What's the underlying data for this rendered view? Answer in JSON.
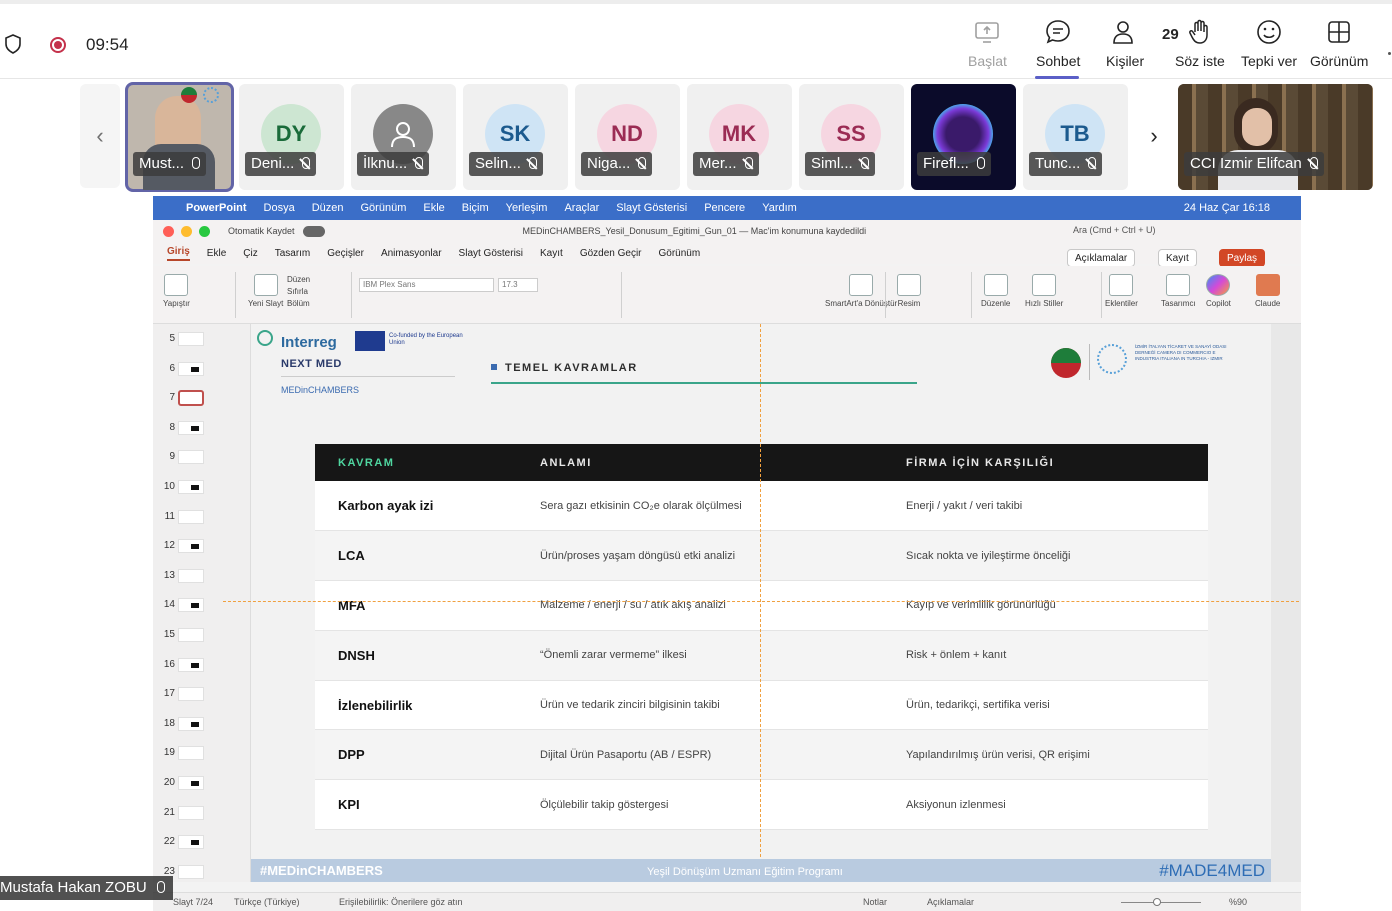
{
  "topbar": {
    "timer": "09:54",
    "buttons": [
      {
        "label": "Başlat",
        "icon": "share-screen-icon"
      },
      {
        "label": "Sohbet",
        "icon": "chat-icon"
      },
      {
        "label": "Kişiler",
        "icon": "people-icon",
        "count": "29"
      },
      {
        "label": "Söz iste",
        "icon": "raise-hand-icon"
      },
      {
        "label": "Tepki ver",
        "icon": "react-icon"
      },
      {
        "label": "Görünüm",
        "icon": "view-icon"
      }
    ],
    "accent": "#5b5fc7"
  },
  "participants": [
    {
      "initials": "",
      "name": "Must..."
    },
    {
      "initials": "DY",
      "name": "Deni..."
    },
    {
      "initials": "",
      "name": "İlknu..."
    },
    {
      "initials": "SK",
      "name": "Selin..."
    },
    {
      "initials": "ND",
      "name": "Niga..."
    },
    {
      "initials": "MK",
      "name": "Mer..."
    },
    {
      "initials": "SS",
      "name": "Siml..."
    },
    {
      "initials": "",
      "name": "Firefl..."
    },
    {
      "initials": "TB",
      "name": "Tunc..."
    }
  ],
  "pinned_video": {
    "name": "CCI Izmir Elifcan"
  },
  "presenter_name": "Mustafa Hakan ZOBU",
  "mac_menu": {
    "app": "PowerPoint",
    "items": [
      "Dosya",
      "Düzen",
      "Görünüm",
      "Ekle",
      "Biçim",
      "Yerleşim",
      "Araçlar",
      "Slayt Gösterisi",
      "Pencere",
      "Yardım"
    ],
    "clock": "24 Haz Çar  16:18"
  },
  "ppt": {
    "autosave": "Otomatik Kaydet",
    "filename": "MEDinCHAMBERS_Yesil_Donusum_Egitimi_Gun_01 — Mac'im konumuna kaydedildi",
    "search": "Ara (Cmd + Ctrl + U)",
    "tabs": [
      "Giriş",
      "Ekle",
      "Çiz",
      "Tasarım",
      "Geçişler",
      "Animasyonlar",
      "Slayt Gösterisi",
      "Kayıt",
      "Gözden Geçir",
      "Görünüm"
    ],
    "comments_btn": "Açıklamalar",
    "record_btn": "Kayıt",
    "share_btn": "Paylaş",
    "ribbon": {
      "paste": "Yapıştır",
      "new_slide": "Yeni Slayt",
      "layout": "Düzen",
      "reset": "Sıfırla",
      "section": "Bölüm",
      "font": "IBM Plex Sans",
      "size": "17.3",
      "smartart": "SmartArt'a Dönüştür",
      "picture": "Resim",
      "arrange": "Düzenle",
      "quick_styles": "Hızlı Stiller",
      "addins": "Eklentiler",
      "designer": "Tasarımcı",
      "copilot": "Copilot",
      "claude": "Claude"
    },
    "thumb_numbers": [
      "5",
      "6",
      "7",
      "8",
      "9",
      "10",
      "11",
      "12",
      "13",
      "14",
      "15",
      "16",
      "17",
      "18",
      "19",
      "20",
      "21",
      "22",
      "23"
    ],
    "status": {
      "slide": "Slayt 7/24",
      "lang": "Türkçe (Türkiye)",
      "access": "Erişilebilirlik: Önerilere göz atın",
      "notes": "Notlar",
      "comments": "Açıklamalar",
      "zoom": "%90"
    }
  },
  "slide": {
    "interreg": "Interreg",
    "eu_text": "Co-funded by the European Union",
    "next_med": "NEXT MED",
    "medin": "MEDinCHAMBERS",
    "section_title": "TEMEL KAVRAMLAR",
    "chamber_text": "İZMİR İTALYAN TİCARET VE SANAYİ ODASI DERNEĞİ CAMERA DI COMMERCIO E INDUSTRIA ITALIANA IN TURCHIA - IZMIR",
    "table": {
      "headers": [
        "KAVRAM",
        "ANLAMI",
        "FİRMA İÇİN KARŞILIĞI"
      ],
      "rows": [
        [
          "Karbon ayak izi",
          "Sera gazı etkisinin CO₂e olarak ölçülmesi",
          "Enerji / yakıt / veri takibi"
        ],
        [
          "LCA",
          "Ürün/proses yaşam döngüsü etki analizi",
          "Sıcak nokta ve iyileştirme önceliği"
        ],
        [
          "MFA",
          "Malzeme / enerji / su / atık akış analizi",
          "Kayıp ve verimlilik görünürlüğü"
        ],
        [
          "DNSH",
          "“Önemli zarar vermeme” ilkesi",
          "Risk + önlem + kanıt"
        ],
        [
          "İzlenebilirlik",
          "Ürün ve tedarik zinciri bilgisinin takibi",
          "Ürün, tedarikçi, sertifika verisi"
        ],
        [
          "DPP",
          "Dijital Ürün Pasaportu (AB / ESPR)",
          "Yapılandırılmış ürün verisi, QR erişimi"
        ],
        [
          "KPI",
          "Ölçülebilir takip göstergesi",
          "Aksiyonun izlenmesi"
        ]
      ]
    },
    "footer_left": "#MEDinCHAMBERS",
    "footer_center": "Yeşil Dönüşüm Uzmanı Eğitim Programı",
    "footer_right": "#MADE4MED"
  }
}
